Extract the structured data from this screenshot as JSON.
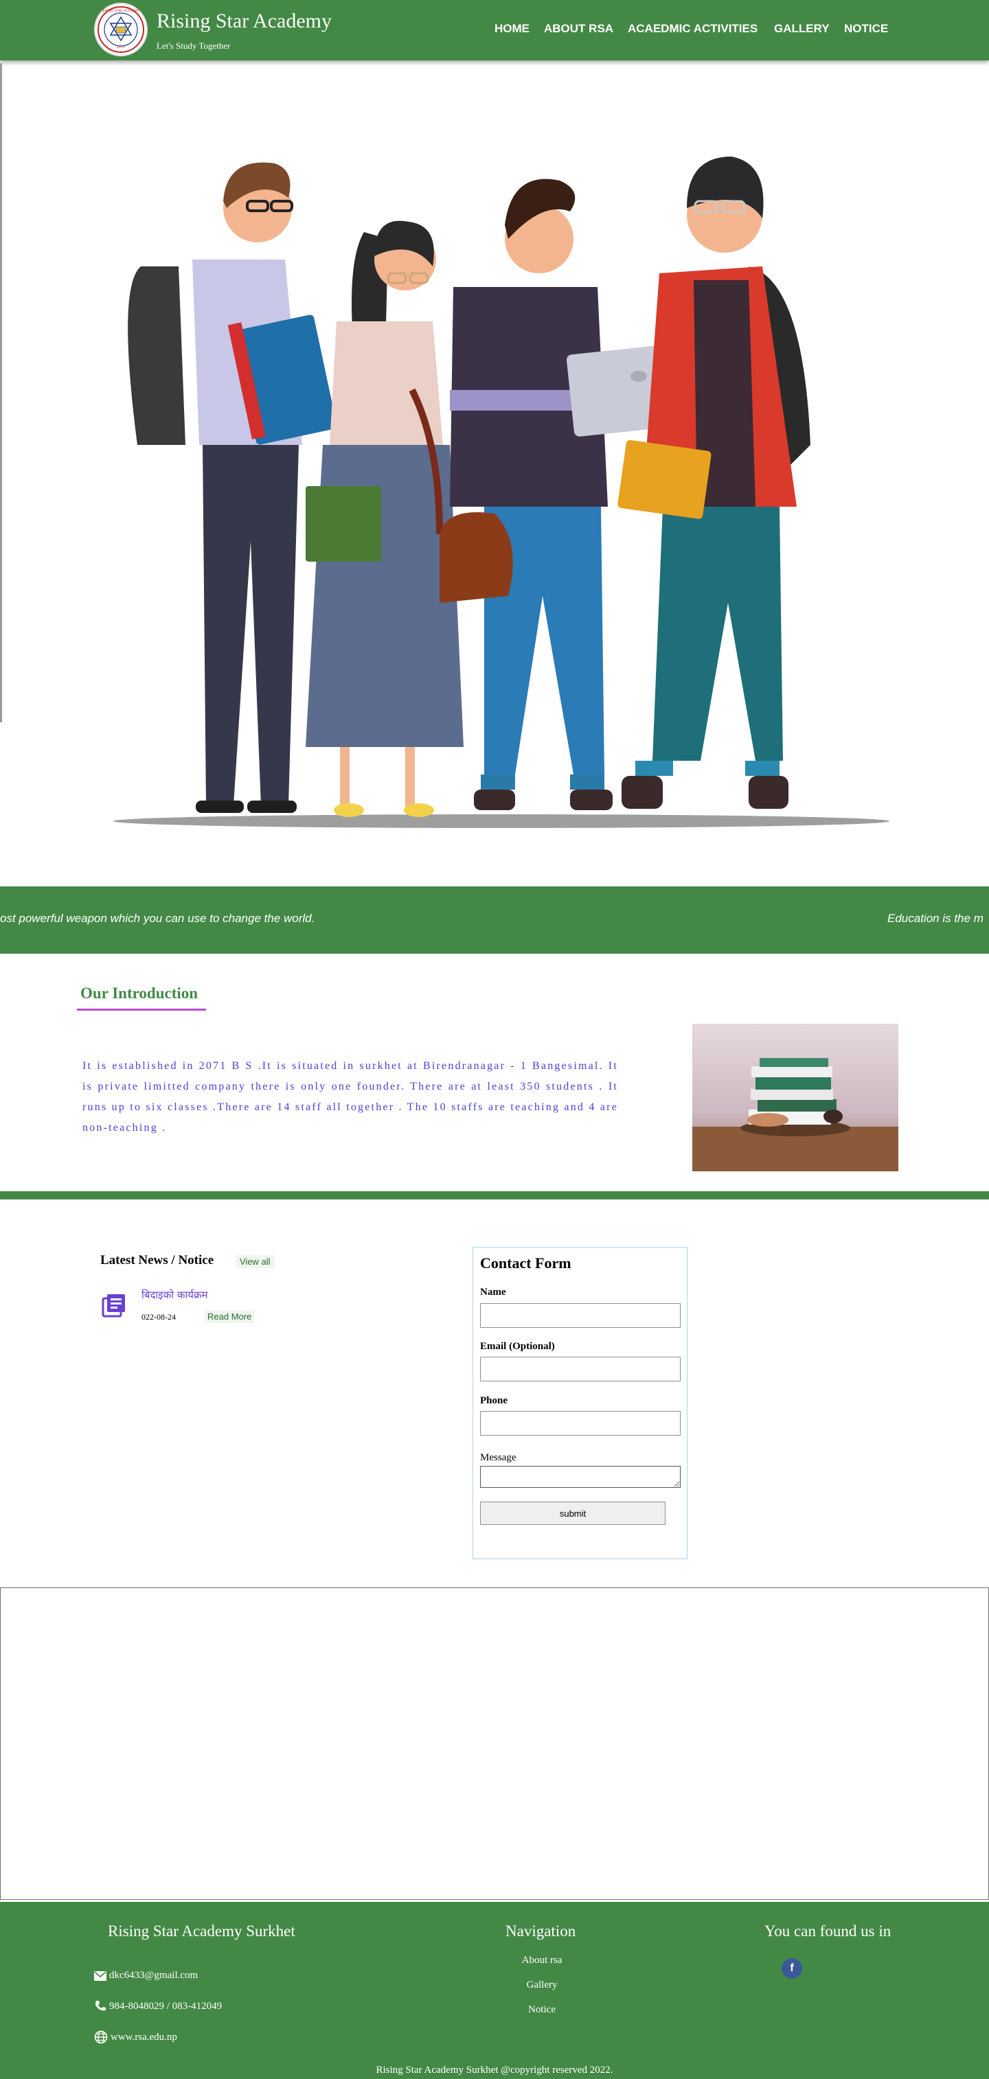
{
  "header": {
    "title": "Rising Star Academy",
    "tagline": "Let's Study Together",
    "logo": {
      "ring_text": "RISING STAR ACADEMY",
      "est_text": "2071"
    },
    "nav": [
      "HOME",
      "ABOUT RSA",
      "ACAEDMIC ACTIVITIES",
      "GALLERY",
      "NOTICE"
    ]
  },
  "marquee": {
    "segment_1": "ost powerful weapon which you can use to change the world.",
    "segment_2": "Education is the m"
  },
  "intro": {
    "heading": "Our Introduction",
    "text": "It is established in 2071 B S .It is situated in surkhet at Birendranagar - 1 Bangesimal. It is private limitted company there is only one founder. There are at least 350 students . It runs up to six classes .There are 14 staff all together . The 10 staffs are teaching and 4 are non-teaching ."
  },
  "news": {
    "title": "Latest News / Notice",
    "view_all": "View all",
    "items": [
      {
        "title": "बिदाइको कार्यक्रम",
        "date": "022-08-24",
        "read_more": "Read More"
      }
    ]
  },
  "contact_form": {
    "title": "Contact Form",
    "name_label": "Name",
    "email_label": "Email (Optional)",
    "phone_label": "Phone",
    "message_label": "Message",
    "submit": "submit"
  },
  "footer": {
    "school_heading": "Rising Star Academy Surkhet",
    "email": "dkc6433@gmail.com",
    "phone": "984-8048029 / 083-412049",
    "website": "www.rsa.edu.np",
    "nav_heading": "Navigation",
    "nav_links": [
      "About rsa",
      "Gallery",
      "Notice"
    ],
    "social_heading": "You can found us in",
    "facebook_glyph": "f",
    "copyright": "Rising Star Academy Surkhet @copyright reserved 2022."
  },
  "colors": {
    "brand_green": "#438945",
    "intro_text": "#4a3fd6",
    "underline": "#b94bd6"
  }
}
